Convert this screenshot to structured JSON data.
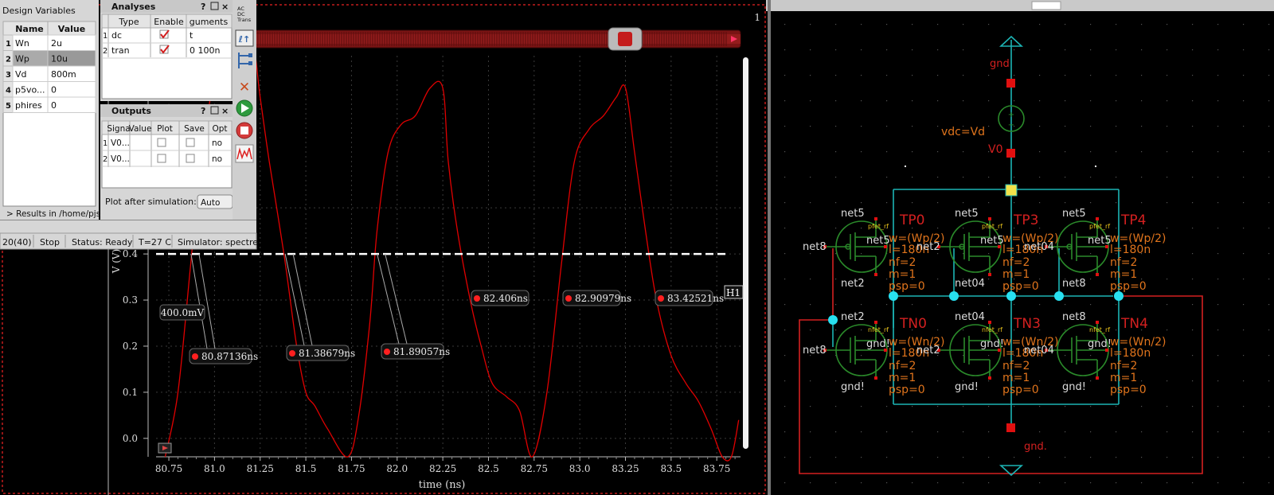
{
  "design_variables": {
    "title": "Design Variables",
    "columns": [
      "Name",
      "Value"
    ],
    "rows": [
      {
        "idx": "1",
        "name": "Wn",
        "value": "2u"
      },
      {
        "idx": "2",
        "name": "Wp",
        "value": "10u"
      },
      {
        "idx": "3",
        "name": "Vd",
        "value": "800m"
      },
      {
        "idx": "4",
        "name": "p5vo...",
        "value": "0"
      },
      {
        "idx": "5",
        "name": "phires",
        "value": "0"
      }
    ],
    "results_path": "> Results in /home/pjs"
  },
  "analyses": {
    "title": "Analyses",
    "columns": [
      "Type",
      "Enable",
      "guments"
    ],
    "rows": [
      {
        "idx": "1",
        "type": "dc",
        "enabled": true,
        "args": "t"
      },
      {
        "idx": "2",
        "type": "tran",
        "enabled": true,
        "args": "0 100n"
      }
    ]
  },
  "outputs": {
    "title": "Outputs",
    "columns": [
      "Signa",
      "Value",
      "Plot",
      "Save",
      "Opt"
    ],
    "rows": [
      {
        "idx": "1",
        "signal": "V0...",
        "save_opt": "no"
      },
      {
        "idx": "2",
        "signal": "V0...",
        "save_opt": "no"
      }
    ],
    "plot_after_label": "Plot after simulation:",
    "plot_after_value": "Auto"
  },
  "panel_icons": {
    "ac_labels": [
      "AC",
      "DC",
      "Trans"
    ]
  },
  "status_bar": {
    "count": "20(40)",
    "stop": "Stop",
    "status": "Status: Ready",
    "temp": "T=27 C",
    "simulator": "Simulator: spectre"
  },
  "waveform": {
    "corner_label": "1",
    "marker_h_label": "H1",
    "threshold_label": "400.0mV",
    "crossing_labels": [
      "80.87136ns",
      "81.38679ns",
      "81.89057ns",
      "82.406ns",
      "82.90979ns",
      "83.42521ns"
    ],
    "trace_color": "#e00000"
  },
  "chart_data": {
    "type": "line",
    "title": "",
    "xlabel": "time (ns)",
    "ylabel": "V (V)",
    "xlim": [
      80.68,
      83.88
    ],
    "ylim": [
      -0.04,
      0.83
    ],
    "xticks": [
      "80.75",
      "81.0",
      "81.25",
      "81.5",
      "81.75",
      "82.0",
      "82.25",
      "82.5",
      "82.75",
      "83.0",
      "83.25",
      "83.5",
      "83.75"
    ],
    "yticks": [
      "0.0",
      "0.1",
      "0.2",
      "0.3",
      "0.4",
      "0.5"
    ],
    "threshold": 0.4,
    "grid": true,
    "series": [
      {
        "x": [
          80.73,
          80.8,
          80.87,
          80.93,
          81.02,
          81.1,
          81.2,
          81.25,
          81.3,
          81.38,
          81.45,
          81.5,
          81.55,
          81.62,
          81.73,
          81.79,
          81.85,
          81.89,
          81.95,
          82.02,
          82.1,
          82.18,
          82.25,
          82.28,
          82.33,
          82.4,
          82.46,
          82.52,
          82.6,
          82.67,
          82.74,
          82.82,
          82.9,
          82.97,
          83.05,
          83.13,
          83.2,
          83.25,
          83.3,
          83.36,
          83.42,
          83.5,
          83.58,
          83.65,
          83.72,
          83.78,
          83.83,
          83.87
        ],
        "y": [
          -0.04,
          0.1,
          0.38,
          0.62,
          0.82,
          0.9,
          0.88,
          0.74,
          0.6,
          0.4,
          0.2,
          0.1,
          0.07,
          0.02,
          -0.04,
          0.05,
          0.25,
          0.45,
          0.62,
          0.68,
          0.7,
          0.76,
          0.76,
          0.6,
          0.45,
          0.3,
          0.2,
          0.12,
          0.09,
          0.06,
          -0.04,
          0.1,
          0.38,
          0.6,
          0.67,
          0.7,
          0.74,
          0.76,
          0.62,
          0.45,
          0.3,
          0.18,
          0.12,
          0.08,
          0.02,
          -0.04,
          -0.04,
          0.04
        ]
      }
    ]
  },
  "schematic": {
    "gnd_top": "gnd",
    "gnd_bottom": "gnd.",
    "source_label": "vdc=Vd",
    "source_name": "V0",
    "pmos": [
      {
        "name": "TP0",
        "gate": "net8",
        "net_top": "net5",
        "net_side": "net5",
        "net_bottom": "net2",
        "model": "pfet_rf",
        "w": "w=(Wp/2)",
        "l": "l=180n",
        "nf": "nf=2",
        "m": "m=1",
        "psp": "psp=0"
      },
      {
        "name": "TP3",
        "gate": "net2",
        "net_top": "net5",
        "net_side": "net5",
        "net_bottom": "net04",
        "model": "pfet_rf",
        "w": "w=(Wp/2)",
        "l": "l=180n",
        "nf": "nf=2",
        "m": "m=1",
        "psp": "psp=0"
      },
      {
        "name": "TP4",
        "gate": "net04",
        "net_top": "net5",
        "net_side": "net5",
        "net_bottom": "net8",
        "model": "pfet_rf",
        "w": "w=(Wp/2)",
        "l": "l=180n",
        "nf": "nf=2",
        "m": "m=1",
        "psp": "psp=0"
      }
    ],
    "nmos": [
      {
        "name": "TN0",
        "gate": "net8",
        "net_top": "net2",
        "net_side": "gnd!",
        "net_bottom": "gnd!",
        "model": "nfet_rf",
        "w": "w=(Wn/2)",
        "l": "l=180n",
        "nf": "nf=2",
        "m": "m=1",
        "psp": "psp=0"
      },
      {
        "name": "TN3",
        "gate": "net2",
        "net_top": "net04",
        "net_side": "gnd!",
        "net_bottom": "gnd!",
        "model": "nfet_rf",
        "w": "w=(Wn/2)",
        "l": "l=180n",
        "nf": "nf=2",
        "m": "m=1",
        "psp": "psp=0"
      },
      {
        "name": "TN4",
        "gate": "net04",
        "net_top": "net8",
        "net_side": "gnd!",
        "net_bottom": "gnd!",
        "model": "nfet_rf",
        "w": "w=(Wn/2)",
        "l": "l=180n",
        "nf": "nf=2",
        "m": "m=1",
        "psp": "psp=0"
      }
    ]
  }
}
